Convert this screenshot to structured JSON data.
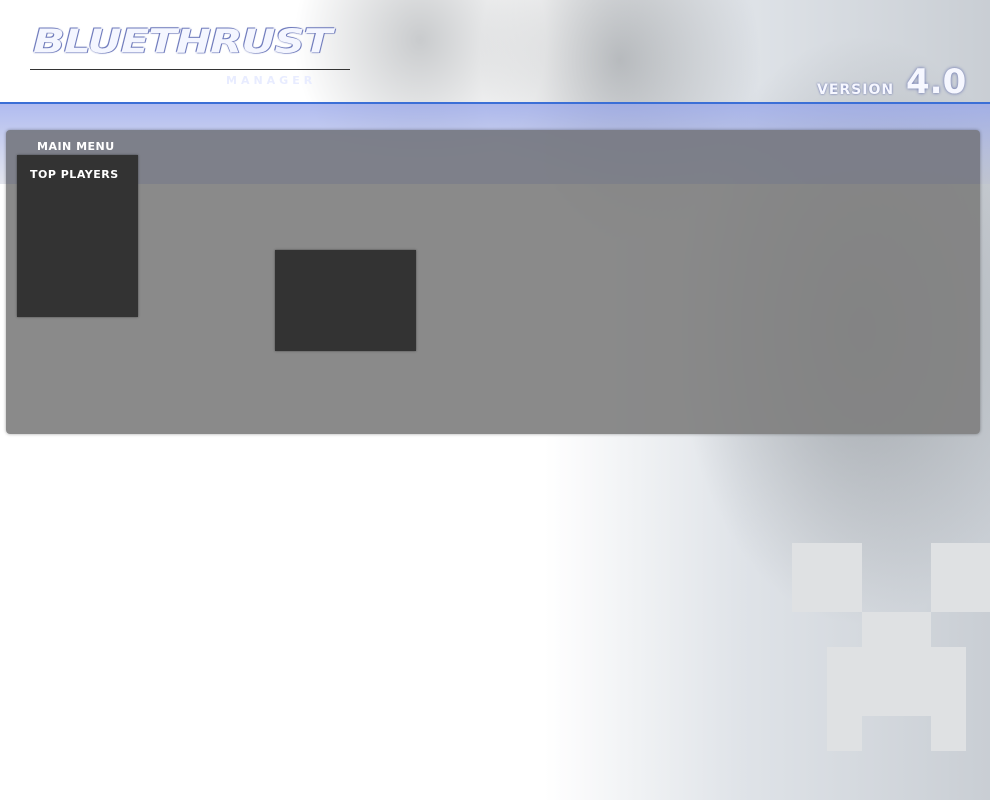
{
  "header": {
    "logo_title": "BLUETHRUST",
    "logo_subtitle": "MANAGER",
    "version_label": "VERSION",
    "version_number": "4.0"
  },
  "nav": {
    "main_menu_label": "MAIN MENU"
  },
  "sidebar": {
    "top_players_title": "TOP PLAYERS"
  },
  "colors": {
    "header_accent": "#3b6fd6",
    "panel_bg": "#808080",
    "box_bg": "#333333"
  }
}
